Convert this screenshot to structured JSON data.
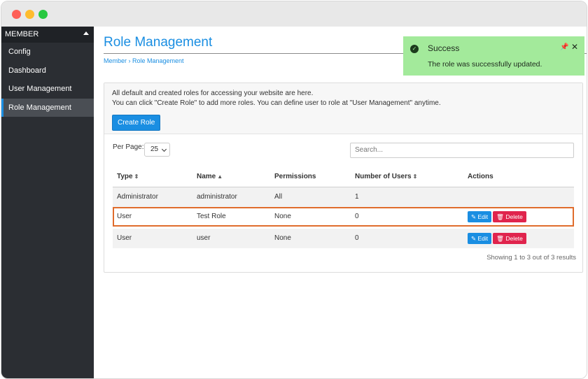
{
  "sidebar": {
    "header": "MEMBER",
    "items": [
      {
        "label": "Config"
      },
      {
        "label": "Dashboard"
      },
      {
        "label": "User Management"
      },
      {
        "label": "Role Management"
      }
    ]
  },
  "page": {
    "title": "Role Management",
    "breadcrumb": "Member › Role Management",
    "info_line1": "All default and created roles for accessing your website are here.",
    "info_line2": "You can click \"Create Role\" to add more roles. You can define user to role at \"User Management\" anytime.",
    "create_button": "Create Role",
    "per_page_label": "Per Page:",
    "per_page_value": "25",
    "search_placeholder": "Search...",
    "results_text": "Showing 1 to 3 out of 3 results"
  },
  "table": {
    "headers": [
      "Type",
      "Name",
      "Permissions",
      "Number of Users",
      "Actions"
    ],
    "rows": [
      {
        "type": "Administrator",
        "name": "administrator",
        "permissions": "All",
        "users": "1"
      },
      {
        "type": "User",
        "name": "Test Role",
        "permissions": "None",
        "users": "0"
      },
      {
        "type": "User",
        "name": "user",
        "permissions": "None",
        "users": "0"
      }
    ],
    "edit_label": "Edit",
    "delete_label": "Delete"
  },
  "toast": {
    "title": "Success",
    "message": "The role was successfully updated."
  },
  "colors": {
    "accent": "#1a8ee2",
    "danger": "#e0244d",
    "toast_bg": "#a3ea9b",
    "highlight": "#e06c2c"
  }
}
